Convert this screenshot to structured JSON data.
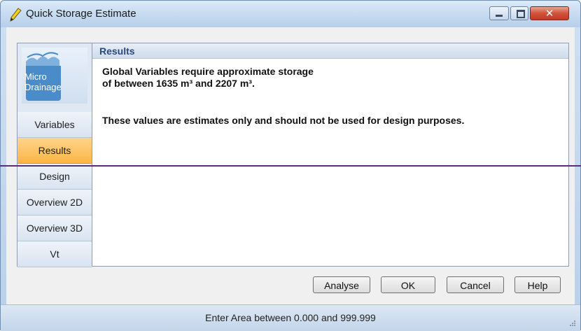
{
  "window": {
    "title": "Quick Storage Estimate",
    "close_glyph": "✕"
  },
  "logo": {
    "line1": "Micro",
    "line2": "Drainage"
  },
  "sidebar": {
    "items": [
      {
        "label": "Variables",
        "active": false
      },
      {
        "label": "Results",
        "active": true
      },
      {
        "label": "Design",
        "active": false
      },
      {
        "label": "Overview 2D",
        "active": false
      },
      {
        "label": "Overview 3D",
        "active": false
      },
      {
        "label": "Vt",
        "active": false
      }
    ]
  },
  "content": {
    "header": "Results",
    "message_line1": "Global Variables require approximate storage",
    "message_line2": "of between 1635 m³ and 2207 m³.",
    "note": "These values are estimates only and should not be used for design purposes."
  },
  "buttons": {
    "analyse": "Analyse",
    "ok": "OK",
    "cancel": "Cancel",
    "help": "Help"
  },
  "status": {
    "text": "Enter Area between 0.000 and 999.999"
  },
  "colors": {
    "active_tab": "#fbb645",
    "header_text": "#28497a",
    "divider": "#5a2d7a"
  }
}
